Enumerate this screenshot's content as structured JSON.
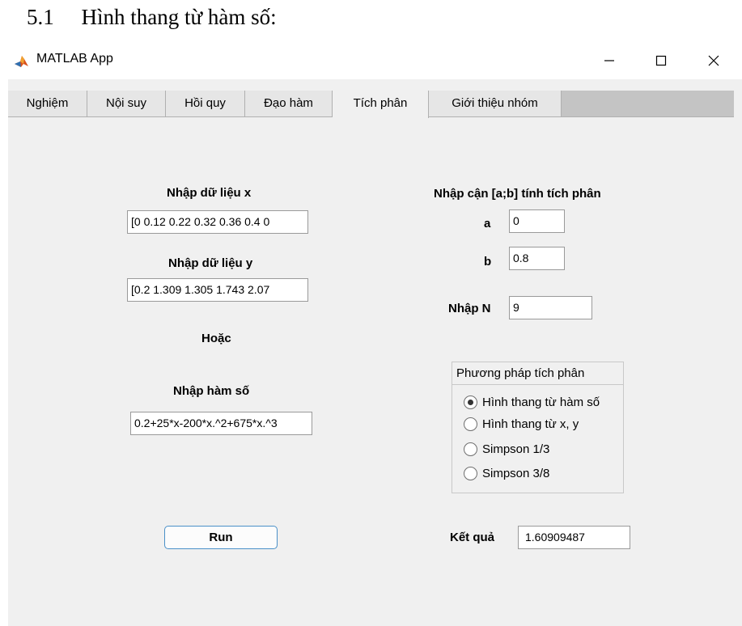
{
  "document": {
    "heading": "5.1  Hình thang từ hàm số:"
  },
  "window": {
    "title": "MATLAB App",
    "icon": "matlab-logo-icon",
    "controls": [
      "minimize-icon",
      "maximize-icon",
      "close-icon"
    ]
  },
  "tabs": [
    {
      "label": "Nghiệm"
    },
    {
      "label": "Nội suy"
    },
    {
      "label": "Hồi quy"
    },
    {
      "label": "Đạo hàm"
    },
    {
      "label": "Tích phân",
      "active": true
    },
    {
      "label": "Giới thiệu nhóm"
    }
  ],
  "left": {
    "x_label": "Nhập dữ liệu x",
    "x_value": "[0 0.12 0.22 0.32 0.36 0.4 0",
    "y_label": "Nhập dữ liệu y",
    "y_value": "[0.2 1.309 1.305 1.743 2.07",
    "or_label": "Hoặc",
    "func_label": "Nhập hàm số",
    "func_value": "0.2+25*x-200*x.^2+675*x.^3",
    "run_label": "Run"
  },
  "right": {
    "bounds_label": "Nhập cận [a;b] tính tích phân",
    "a_label": "a",
    "a_value": "0",
    "b_label": "b",
    "b_value": "0.8",
    "n_label": "Nhập N",
    "n_value": "9",
    "method_title": "Phương pháp tích phân",
    "methods": [
      {
        "label": "Hình thang từ hàm số",
        "selected": true
      },
      {
        "label": "Hình thang từ x, y",
        "selected": false
      },
      {
        "label": "Simpson 1/3",
        "selected": false
      },
      {
        "label": "Simpson 3/8",
        "selected": false
      }
    ],
    "result_label": "Kết quả",
    "result_value": "1.60909487"
  }
}
